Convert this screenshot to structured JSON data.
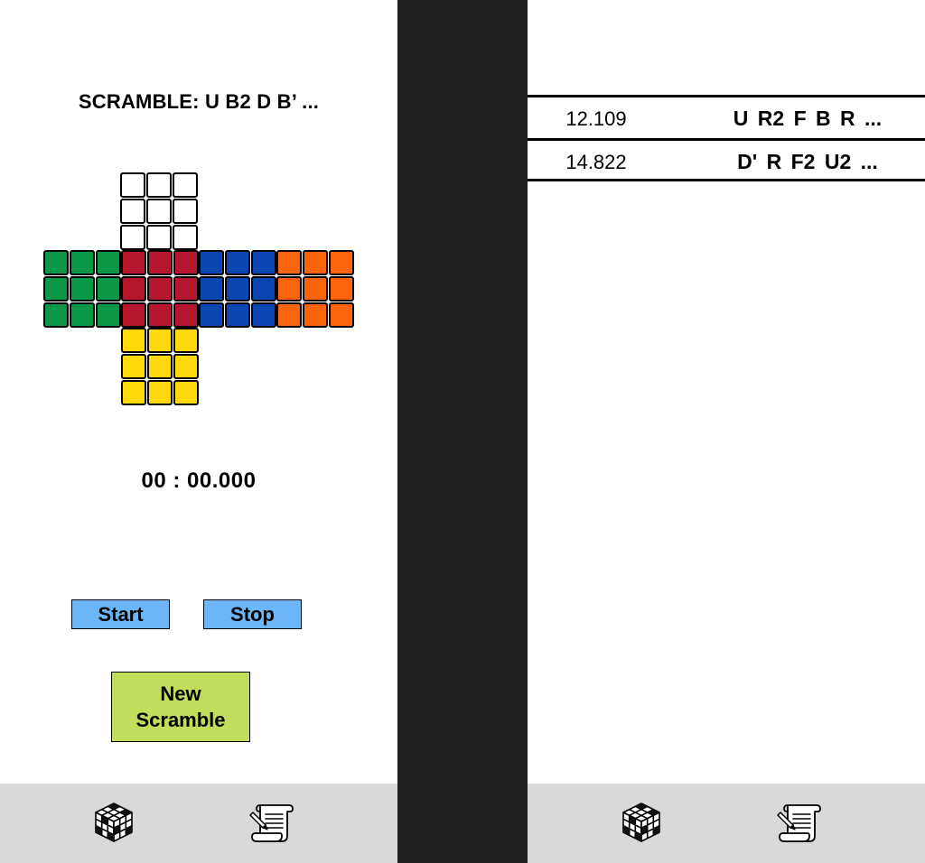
{
  "timer_screen": {
    "scramble_label": "SCRAMBLE: U B2 D B’ ...",
    "cube_faces": {
      "up": "#ffffff",
      "left": "#0a9847",
      "front": "#b5172f",
      "right": "#0c46b3",
      "back": "#fd650d",
      "down": "#ffd90a"
    },
    "timer_value": "00 : 00.000",
    "start_label": "Start",
    "stop_label": "Stop",
    "new_scramble_line1": "New",
    "new_scramble_line2": "Scramble",
    "tab_bar": {
      "icons": [
        "cube-icon",
        "scroll-log-icon"
      ]
    }
  },
  "history_screen": {
    "rows": [
      {
        "time": "12.109",
        "scramble": "U R2 F B R ..."
      },
      {
        "time": "14.822",
        "scramble": "D' R F2 U2 ..."
      }
    ],
    "tab_bar": {
      "icons": [
        "cube-icon",
        "scroll-log-icon"
      ]
    }
  },
  "colors": {
    "start_stop_button": "#6ab6f6",
    "new_scramble_button": "#c0de5c",
    "tab_bar_bg": "#d9d9d9",
    "divider_band": "#202020"
  }
}
